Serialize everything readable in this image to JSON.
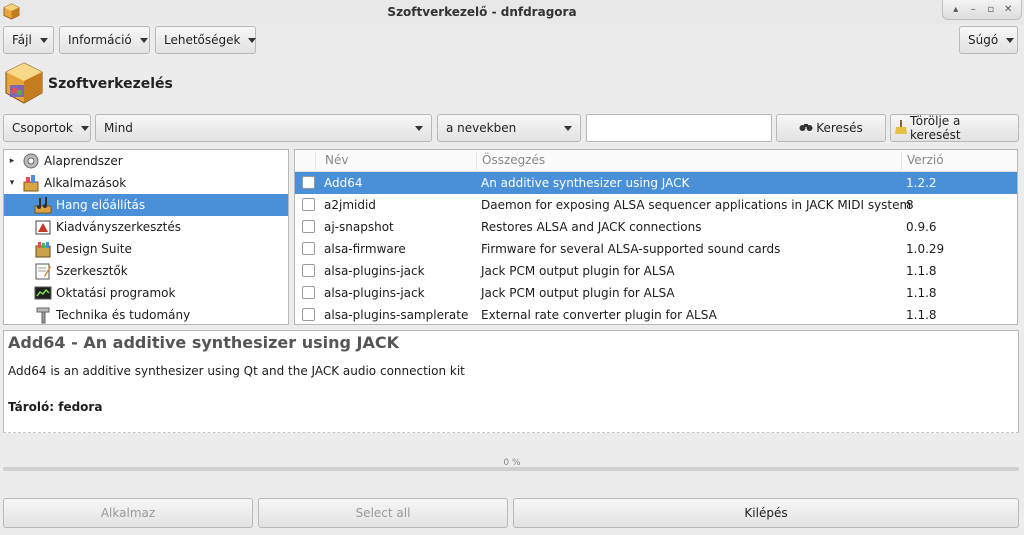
{
  "window": {
    "title": "Szoftverkezelő - dnfdragora",
    "controls": [
      "up-icon",
      "minimize-icon",
      "maximize-icon",
      "close-icon"
    ]
  },
  "menu": {
    "file": "Fájl",
    "info": "Információ",
    "options": "Lehetőségek",
    "help": "Súgó"
  },
  "header": {
    "title": "Szoftverkezelés"
  },
  "filters": {
    "groups": "Csoportok",
    "filter_value": "Mind",
    "match_value": "a nevekben",
    "search_value": "",
    "search_button": "Keresés",
    "clear_button": "Törölje a keresést"
  },
  "tree": {
    "items": [
      {
        "label": "Alaprendszer",
        "icon": "gear-icon",
        "expander": "▸",
        "level": 0,
        "selected": false
      },
      {
        "label": "Alkalmazások",
        "icon": "applications-icon",
        "expander": "▾",
        "level": 0,
        "selected": false
      },
      {
        "label": "Hang előállítás",
        "icon": "music-icon",
        "expander": "",
        "level": 1,
        "selected": true
      },
      {
        "label": "Kiadványszerkesztés",
        "icon": "publishing-icon",
        "expander": "",
        "level": 1,
        "selected": false
      },
      {
        "label": "Design Suite",
        "icon": "design-icon",
        "expander": "",
        "level": 1,
        "selected": false
      },
      {
        "label": "Szerkesztők",
        "icon": "editor-icon",
        "expander": "",
        "level": 1,
        "selected": false
      },
      {
        "label": "Oktatási programok",
        "icon": "education-icon",
        "expander": "",
        "level": 1,
        "selected": false
      },
      {
        "label": "Technika és tudomány",
        "icon": "science-icon",
        "expander": "",
        "level": 1,
        "selected": false
      }
    ]
  },
  "packages": {
    "columns": {
      "name": "Név",
      "summary": "Összegzés",
      "version": "Verzió"
    },
    "rows": [
      {
        "name": "Add64",
        "summary": "An additive synthesizer using JACK",
        "version": "1.2.2",
        "selected": true
      },
      {
        "name": "a2jmidid",
        "summary": "Daemon for exposing ALSA sequencer applications in JACK MIDI system",
        "version": "8",
        "selected": false
      },
      {
        "name": "aj-snapshot",
        "summary": "Restores ALSA and JACK connections",
        "version": "0.9.6",
        "selected": false
      },
      {
        "name": "alsa-firmware",
        "summary": "Firmware for several ALSA-supported sound cards",
        "version": "1.0.29",
        "selected": false
      },
      {
        "name": "alsa-plugins-jack",
        "summary": "Jack PCM output plugin for ALSA",
        "version": "1.1.8",
        "selected": false
      },
      {
        "name": "alsa-plugins-jack",
        "summary": "Jack PCM output plugin for ALSA",
        "version": "1.1.8",
        "selected": false
      },
      {
        "name": "alsa-plugins-samplerate",
        "summary": "External rate converter plugin for ALSA",
        "version": "1.1.8",
        "selected": false
      }
    ]
  },
  "description": {
    "title": "Add64 - An additive synthesizer using JACK",
    "text": "Add64 is an additive synthesizer using Qt and the JACK audio connection kit",
    "repo": "Tároló: fedora"
  },
  "progress": {
    "value": 0,
    "text": "0 %"
  },
  "actions": {
    "apply": "Alkalmaz",
    "select_all": "Select all",
    "quit": "Kilépés"
  },
  "colors": {
    "selection": "#4a90d9",
    "background": "#ececec"
  }
}
